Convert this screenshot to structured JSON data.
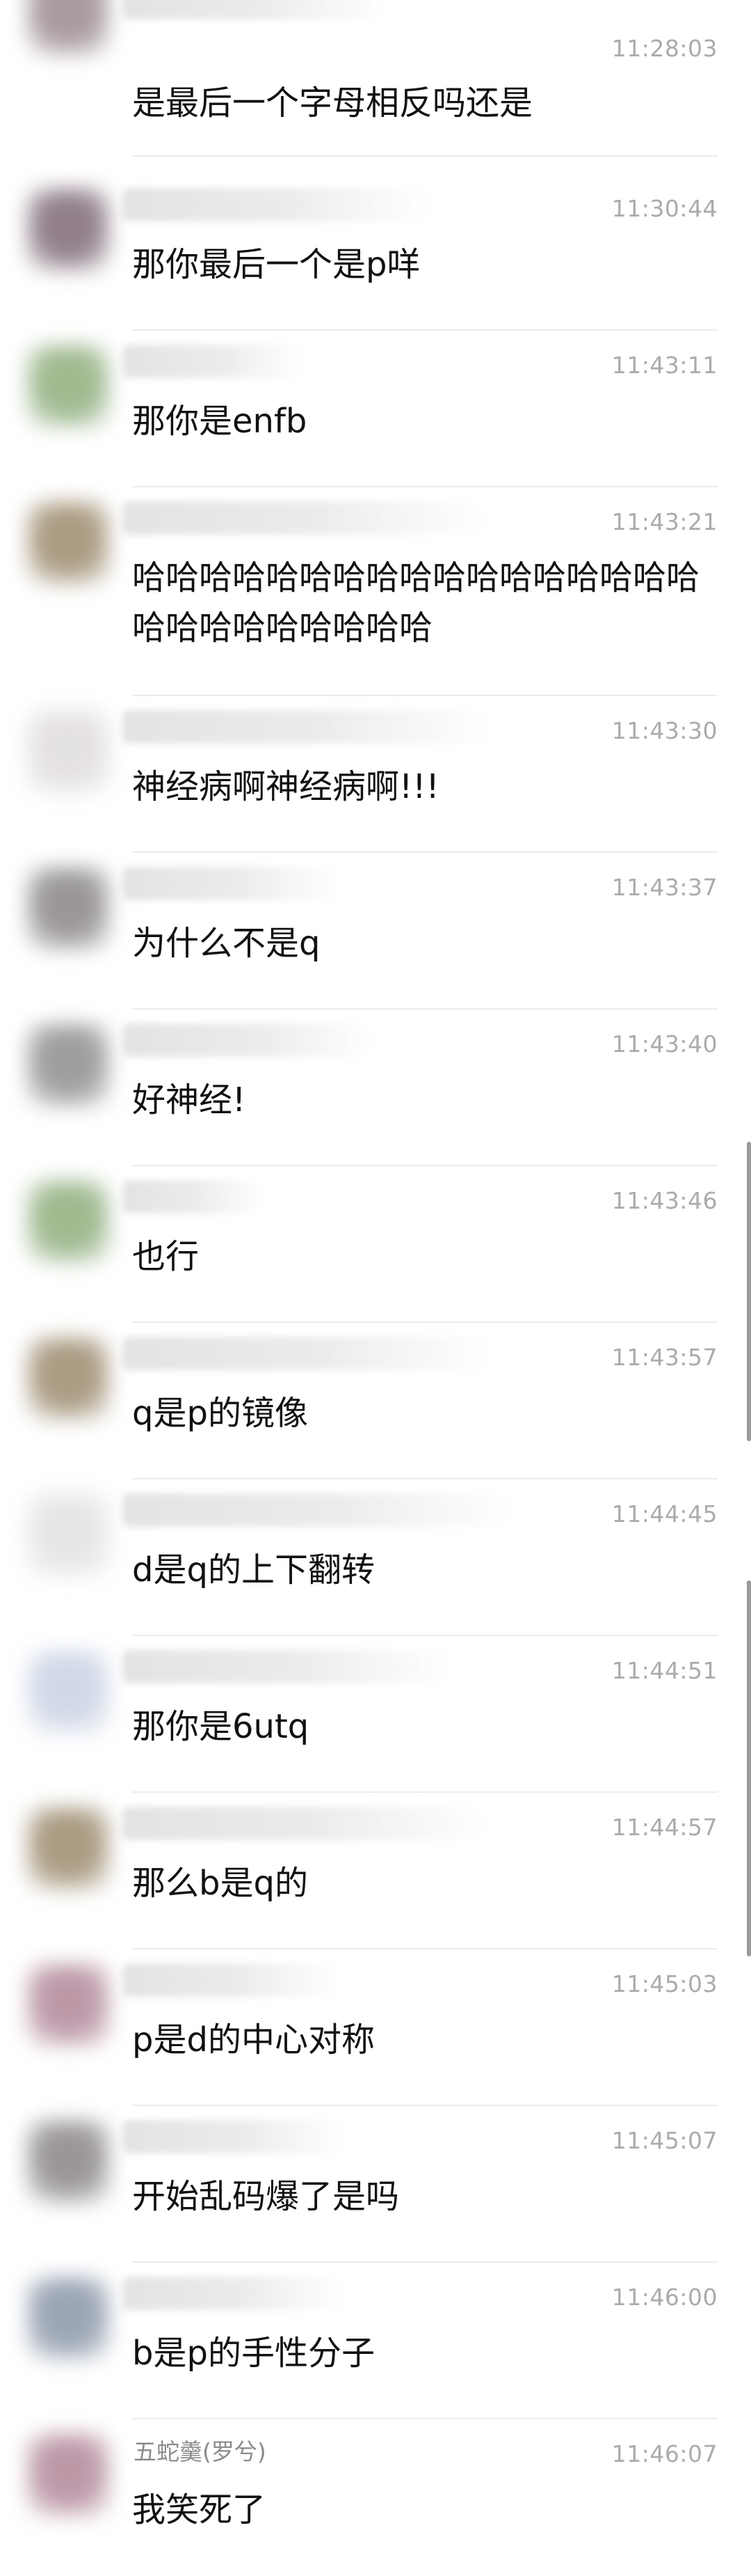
{
  "messages": [
    {
      "time": "11:28:03",
      "text": "是最后一个字母相反吗还是",
      "name": "",
      "avatar_color": "#9a8a8e"
    },
    {
      "time": "11:30:44",
      "text": "那你最后一个是p咩",
      "name": "",
      "avatar_color": "#7e6a78"
    },
    {
      "time": "11:43:11",
      "text": "那你是enfb",
      "name": "",
      "avatar_color": "#8fae7c"
    },
    {
      "time": "11:43:21",
      "text": "哈哈哈哈哈哈哈哈哈哈哈哈哈哈哈哈哈哈哈哈哈哈哈哈哈哈",
      "name": "",
      "avatar_color": "#9c8b6d"
    },
    {
      "time": "11:43:30",
      "text": "神经病啊神经病啊!!!",
      "name": "",
      "avatar_color": "#e0dcdc"
    },
    {
      "time": "11:43:37",
      "text": "为什么不是q",
      "name": "",
      "avatar_color": "#8a8688"
    },
    {
      "time": "11:43:40",
      "text": "好神经!",
      "name": "",
      "avatar_color": "#8f8c8e"
    },
    {
      "time": "11:43:46",
      "text": "也行",
      "name": "",
      "avatar_color": "#8fae7c"
    },
    {
      "time": "11:43:57",
      "text": "q是p的镜像",
      "name": "",
      "avatar_color": "#9c8b6d"
    },
    {
      "time": "11:44:45",
      "text": "d是q的上下翻转",
      "name": "",
      "avatar_color": "#e4e1e1"
    },
    {
      "time": "11:44:51",
      "text": "那你是6utq",
      "name": "",
      "avatar_color": "#c9d2e4"
    },
    {
      "time": "11:44:57",
      "text": "那么b是q的",
      "name": "",
      "avatar_color": "#9c8b6d"
    },
    {
      "time": "11:45:03",
      "text": "p是d的中心对称",
      "name": "",
      "avatar_color": "#b2889a"
    },
    {
      "time": "11:45:07",
      "text": "开始乱码爆了是吗",
      "name": "",
      "avatar_color": "#8a8688"
    },
    {
      "time": "11:46:00",
      "text": "b是p的手性分子",
      "name": "",
      "avatar_color": "#8a96a8"
    },
    {
      "time": "11:46:07",
      "text": "我笑死了",
      "name": "五蛇羹(罗兮)",
      "avatar_color": "#b2889a"
    }
  ]
}
